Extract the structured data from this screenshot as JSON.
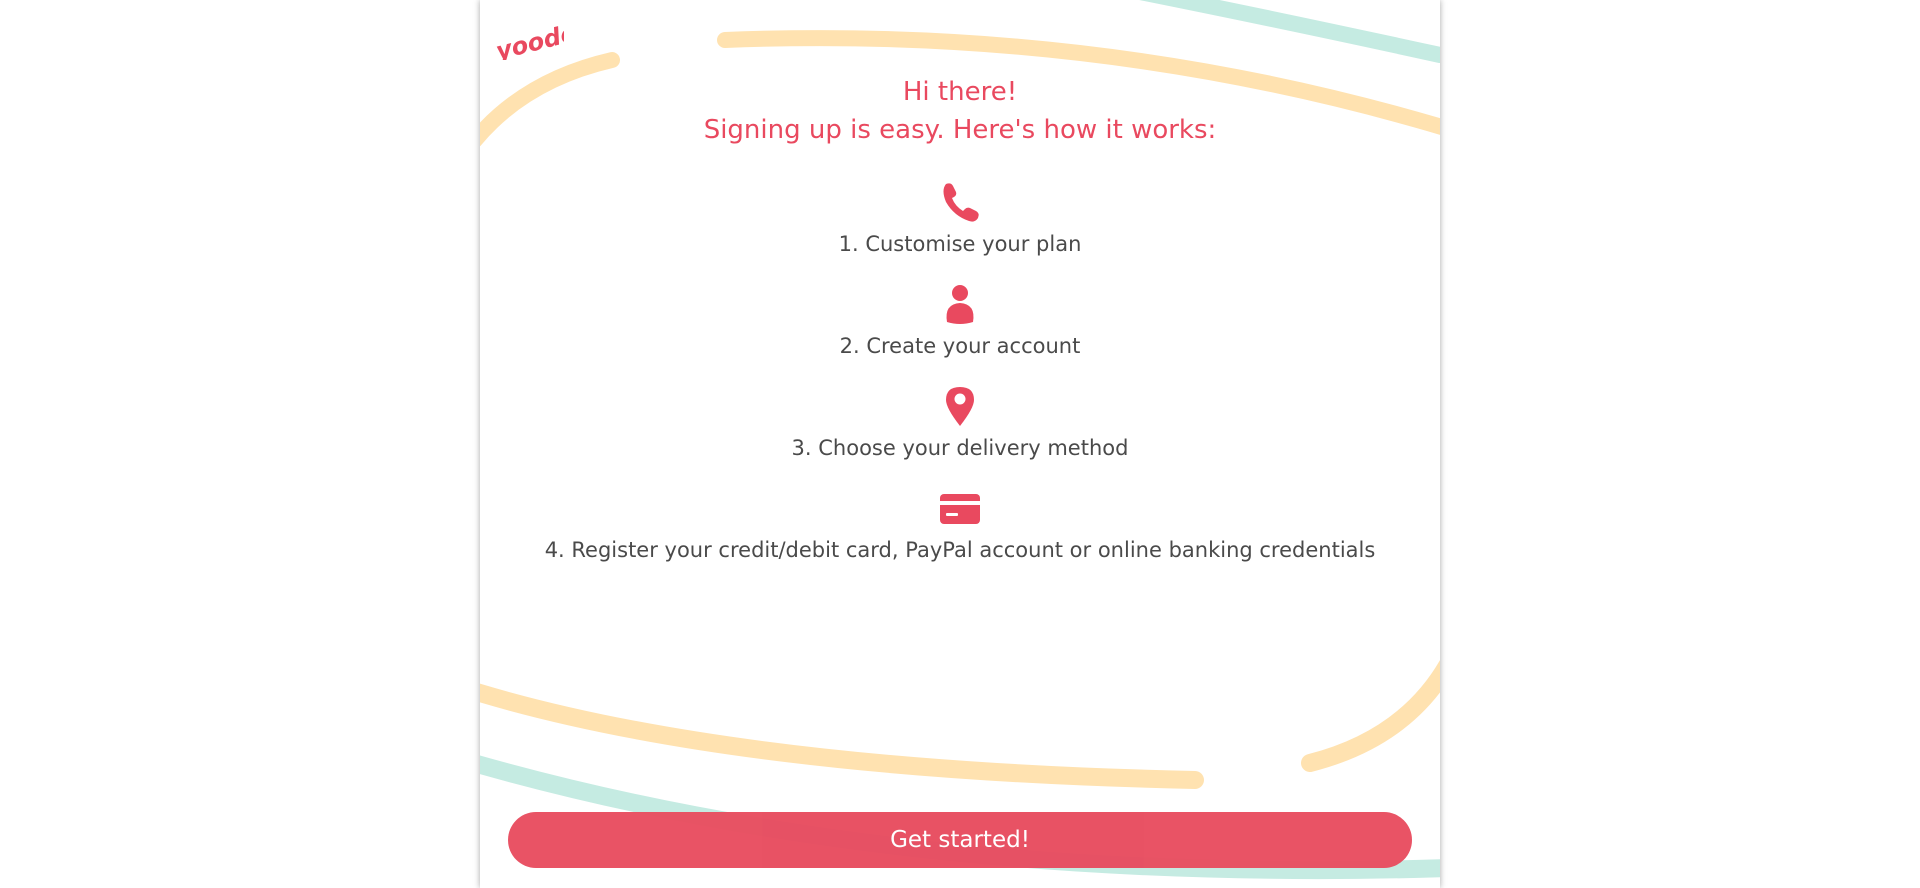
{
  "brand": {
    "logo_text": "yoodo",
    "accent_color": "#e9495f",
    "button_color": "#e84d60",
    "swoosh_yellow": "#ffe2b0",
    "swoosh_teal": "#c5ebe2"
  },
  "intro": {
    "greeting": "Hi there!",
    "subtitle": "Signing up is easy. Here's how it works:"
  },
  "steps": [
    {
      "icon": "phone-icon",
      "label": "1. Customise your plan"
    },
    {
      "icon": "user-icon",
      "label": "2. Create your account"
    },
    {
      "icon": "map-pin-icon",
      "label": "3. Choose your delivery method"
    },
    {
      "icon": "credit-card-icon",
      "label": "4. Register your credit/debit card, PayPal account or online banking credentials"
    }
  ],
  "cta": {
    "label": "Get started!"
  }
}
